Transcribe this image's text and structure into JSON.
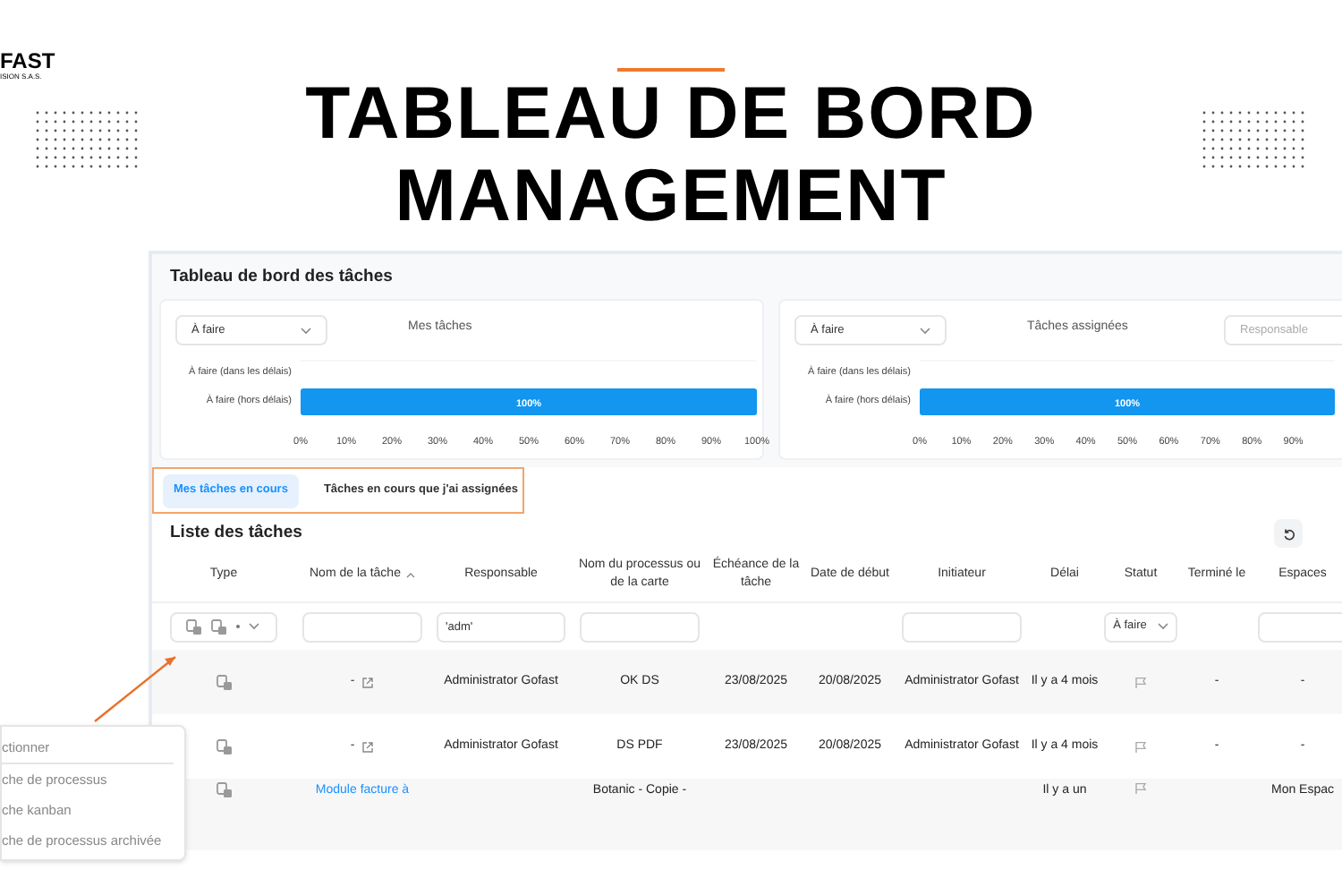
{
  "brand": {
    "name": "FAST",
    "tagline": "ISION S.A.S."
  },
  "headline": [
    "TABLEAU DE BORD",
    "MANAGEMENT"
  ],
  "dashboard": {
    "title": "Tableau de bord des tâches",
    "panels": [
      {
        "filter": "À faire",
        "title": "Mes tâches",
        "chart_data": {
          "type": "bar",
          "orientation": "horizontal",
          "categories": [
            "À faire (dans les délais)",
            "À faire (hors délais)"
          ],
          "values": [
            0,
            100
          ],
          "xlim": [
            0,
            100
          ],
          "xticks": [
            {
              "value": 0,
              "label": "0%"
            },
            {
              "value": 10,
              "label": "10%"
            },
            {
              "value": 20,
              "label": "20%"
            },
            {
              "value": 30,
              "label": "30%"
            },
            {
              "value": 40,
              "label": "40%"
            },
            {
              "value": 50,
              "label": "50%"
            },
            {
              "value": 60,
              "label": "60%"
            },
            {
              "value": 70,
              "label": "70%"
            },
            {
              "value": 80,
              "label": "80%"
            },
            {
              "value": 90,
              "label": "90%"
            },
            {
              "value": 100,
              "label": "100%"
            }
          ],
          "value_labels": [
            null,
            "100%"
          ]
        }
      },
      {
        "filter": "À faire",
        "title": "Tâches assignées",
        "responsible_placeholder": "Responsable",
        "chart_data": {
          "type": "bar",
          "orientation": "horizontal",
          "categories": [
            "À faire (dans les délais)",
            "À faire (hors délais)"
          ],
          "values": [
            0,
            100
          ],
          "xlim": [
            0,
            100
          ],
          "xticks": [
            {
              "value": 0,
              "label": "0%"
            },
            {
              "value": 10,
              "label": "10%"
            },
            {
              "value": 20,
              "label": "20%"
            },
            {
              "value": 30,
              "label": "30%"
            },
            {
              "value": 40,
              "label": "40%"
            },
            {
              "value": 50,
              "label": "50%"
            },
            {
              "value": 60,
              "label": "60%"
            },
            {
              "value": 70,
              "label": "70%"
            },
            {
              "value": 80,
              "label": "80%"
            },
            {
              "value": 90,
              "label": "90%"
            }
          ],
          "value_labels": [
            null,
            "100%"
          ]
        }
      }
    ]
  },
  "tabs": [
    {
      "label": "Mes tâches en cours",
      "selected": true
    },
    {
      "label": "Tâches en cours que j'ai assignées",
      "selected": false
    }
  ],
  "task_list": {
    "title": "Liste des tâches",
    "columns": [
      {
        "label": "Type",
        "sorted": false,
        "filter": {
          "kind": "type_select"
        }
      },
      {
        "label": "Nom de la tâche",
        "sorted": true,
        "filter": {
          "kind": "input"
        }
      },
      {
        "label": "Responsable",
        "sorted": false,
        "filter": {
          "kind": "input",
          "value": "'adm'"
        }
      },
      {
        "label": "Nom du processus ou de la carte",
        "sorted": false,
        "filter": {
          "kind": "input"
        }
      },
      {
        "label": "Échéance de la tâche",
        "sorted": false
      },
      {
        "label": "Date de début",
        "sorted": false
      },
      {
        "label": "Initiateur",
        "sorted": false,
        "filter": {
          "kind": "input"
        }
      },
      {
        "label": "Délai",
        "sorted": false
      },
      {
        "label": "Statut",
        "sorted": false,
        "filter": {
          "kind": "select",
          "value": "À faire"
        }
      },
      {
        "label": "Terminé le",
        "sorted": false
      },
      {
        "label": "Espaces",
        "sorted": false,
        "filter": {
          "kind": "input"
        }
      }
    ],
    "rows": [
      {
        "task": "-",
        "task_is_link": false,
        "responsible": "Administrator Gofast",
        "process": "OK DS",
        "due": "23/08/2025",
        "start": "20/08/2025",
        "initiator": "Administrator Gofast",
        "delay": "Il y a 4 mois",
        "finished": "-",
        "space": "-"
      },
      {
        "task": "-",
        "task_is_link": false,
        "responsible": "Administrator Gofast",
        "process": "DS PDF",
        "due": "23/08/2025",
        "start": "20/08/2025",
        "initiator": "Administrator Gofast",
        "delay": "Il y a 4 mois",
        "finished": "-",
        "space": "-"
      },
      {
        "task": "Module facture à",
        "task_is_link": true,
        "process": "Botanic - Copie -",
        "delay": "Il y a un",
        "space": "Mon Espac"
      }
    ]
  },
  "type_menu": {
    "items": [
      "ctionner",
      "che de processus",
      "che kanban",
      "che de processus archivée"
    ]
  }
}
